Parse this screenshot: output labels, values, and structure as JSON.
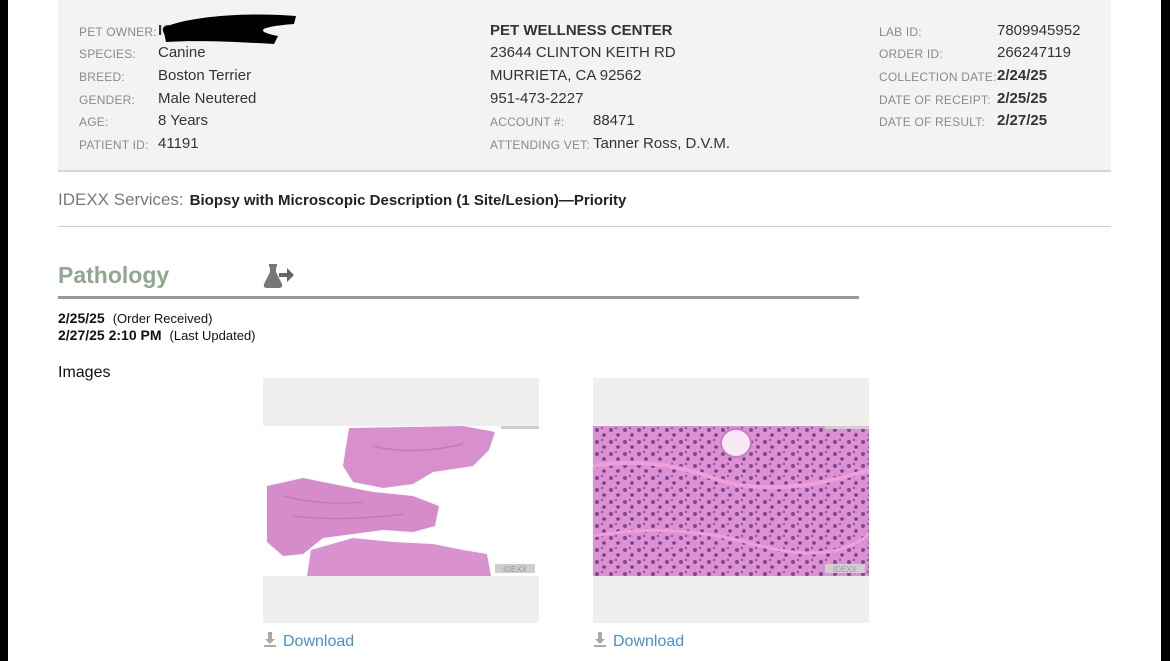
{
  "owner": {
    "label": "PET OWNER:",
    "value": "IO"
  },
  "patient_fields": [
    {
      "label": "SPECIES:",
      "value": "Canine"
    },
    {
      "label": "BREED:",
      "value": "Boston Terrier"
    },
    {
      "label": "GENDER:",
      "value": "Male Neutered"
    },
    {
      "label": "AGE:",
      "value": "8 Years"
    },
    {
      "label": "PATIENT ID:",
      "value": "41191"
    }
  ],
  "clinic": {
    "name": "PET WELLNESS CENTER",
    "address1": "23644 CLINTON KEITH RD",
    "address2": "MURRIETA, CA 92562",
    "phone": "951-473-2227",
    "account_label": "ACCOUNT #:",
    "account_value": "88471",
    "vet_label": "ATTENDING VET:",
    "vet_value": "Tanner Ross, D.V.M."
  },
  "lab_fields": [
    {
      "label": "LAB ID:",
      "value": "7809945952"
    },
    {
      "label": "ORDER ID:",
      "value": "266247119"
    },
    {
      "label": "COLLECTION DATE:",
      "value": "2/24/25"
    },
    {
      "label": "DATE OF RECEIPT:",
      "value": "2/25/25"
    },
    {
      "label": "DATE OF RESULT:",
      "value": "2/27/25"
    }
  ],
  "services": {
    "label": "IDEXX Services:",
    "description": "Biopsy with Microscopic Description (1 Site/Lesion)—Priority"
  },
  "pathology": {
    "title": "Pathology",
    "order_received_date": "2/25/25",
    "order_received_note": "(Order Received)",
    "last_updated_date": "2/27/25 2:10 PM",
    "last_updated_note": "(Last Updated)",
    "images_label": "Images",
    "images": [
      {
        "watermark": "IDEXX",
        "download_label": "Download"
      },
      {
        "watermark": "IDEXX",
        "download_label": "Download"
      }
    ]
  },
  "colors": {
    "pathology_title": "#8fa88f",
    "download_link": "#4a90c8",
    "tissue_pink": "#d98fcf"
  }
}
